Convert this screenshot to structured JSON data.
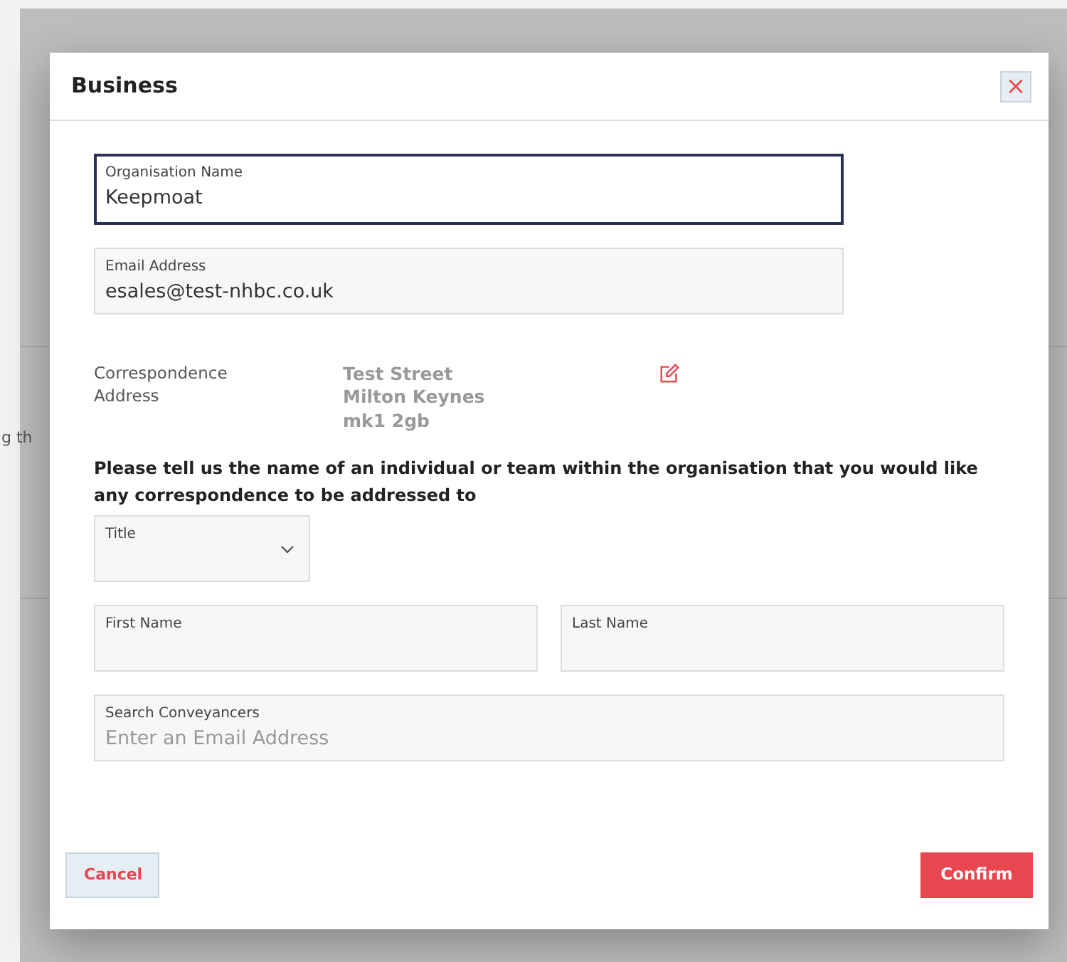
{
  "background": {
    "text": "g th"
  },
  "dialog": {
    "title": "Business",
    "close": "×"
  },
  "fields": [
    {
      "kind": "text",
      "label": "Organisation Name",
      "value": "Keepmoat",
      "focused": true
    },
    {
      "kind": "text",
      "label": "Email Address",
      "value": "esales@test-nhbc.co.uk",
      "focused": false
    }
  ],
  "address": {
    "label": "Correspondence Address",
    "lines": [
      "Test Street",
      "Milton Keynes",
      "mk1 2gb"
    ]
  },
  "instruction": "Please tell us the name of an individual or team within the organisation that you would like any correspondence to be addressed to",
  "contact_fields": [
    {
      "kind": "select",
      "label": "Title",
      "focused": false
    },
    {
      "kind": "text",
      "label": "First Name",
      "focused": false
    },
    {
      "kind": "text",
      "label": "Last Name",
      "focused": false
    },
    {
      "kind": "text",
      "label": "Search Conveyancers",
      "placeholder": "Enter an Email Address",
      "focused": false
    }
  ],
  "buttons": [
    {
      "kind": "secondary",
      "label": "Cancel"
    },
    {
      "kind": "primary",
      "label": "Confirm"
    }
  ]
}
